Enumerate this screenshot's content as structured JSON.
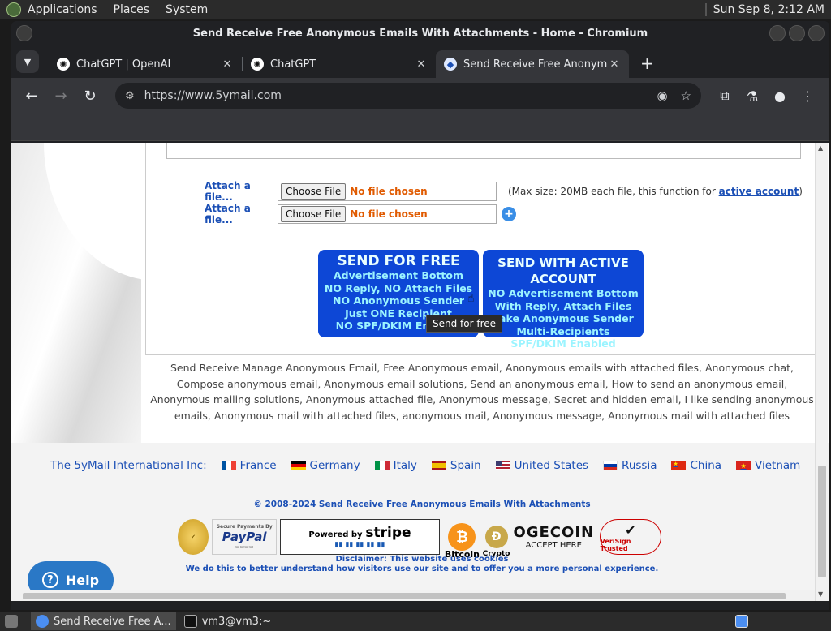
{
  "topbar": {
    "menus": [
      "Applications",
      "Places",
      "System"
    ],
    "clock": "Sun Sep  8,  2:12 AM"
  },
  "window": {
    "title": "Send Receive Free Anonymous Emails With Attachments - Home - Chromium"
  },
  "tabs": [
    {
      "title": "ChatGPT | OpenAI",
      "active": false
    },
    {
      "title": "ChatGPT",
      "active": false
    },
    {
      "title": "Send Receive Free Anonymou",
      "active": true
    }
  ],
  "omnibox": {
    "url": "https://www.5ymail.com"
  },
  "attach": {
    "label": "Attach a file...",
    "button": "Choose File",
    "none": "No file chosen",
    "max_prefix": "(Max size: 20MB each file, this function for ",
    "max_link": "active account",
    "max_suffix": ")"
  },
  "send_free": {
    "head": "SEND FOR FREE",
    "lines": [
      "Advertisement Bottom",
      "NO Reply, NO Attach Files",
      "NO Anonymous Sender",
      "Just ONE Recipient",
      "NO SPF/DKIM Enabled"
    ]
  },
  "send_active": {
    "head": "SEND WITH ACTIVE ACCOUNT",
    "lines": [
      "NO Advertisement Bottom",
      "With Reply, Attach Files",
      "Fake Anonymous Sender",
      "Multi-Recipients",
      "SPF/DKIM Enabled"
    ]
  },
  "tooltip": "Send for free",
  "description": "Send Receive Manage Anonymous Email, Free Anonymous email, Anonymous emails with attached files, Anonymous chat, Compose anonymous email, Anonymous email solutions, Send an anonymous email, How to send an anonymous email, Anonymous mailing solutions, Anonymous attached file, Anonymous message, Secret and hidden email, I like sending anonymous emails, Anonymous mail with attached files, anonymous mail, Anonymous message, Anonymous mail with attached files",
  "international": {
    "label": "The 5yMail International Inc:",
    "countries": [
      "France",
      "Germany",
      "Italy",
      "Spain",
      "United States",
      "Russia",
      "China",
      "Vietnam"
    ]
  },
  "copyright": "© 2008-2024 Send Receive Free Anonymous Emails With Attachments",
  "badges": {
    "paypal_small": "Secure Payments By",
    "paypal": "PayPal",
    "stripe_small": "Powered by",
    "stripe": "stripe",
    "bitcoin": "Bitcoin",
    "crypto": "Crypto",
    "dogecoin": "OGECOIN",
    "accept": "ACCEPT HERE",
    "verisign": "VeriSign Trusted"
  },
  "disclaimer": {
    "line1": "Disclaimer: This website uses cookies",
    "line2": "We do this to better understand how visitors use our site and to offer you a more personal experience."
  },
  "help": "Help",
  "taskbar": {
    "items": [
      "Send Receive Free A...",
      "vm3@vm3:~"
    ]
  },
  "colors": {
    "link": "#1b4fb5",
    "send_button": "#0d47d6",
    "file_none": "#e05a00",
    "help": "#2a78c6"
  }
}
